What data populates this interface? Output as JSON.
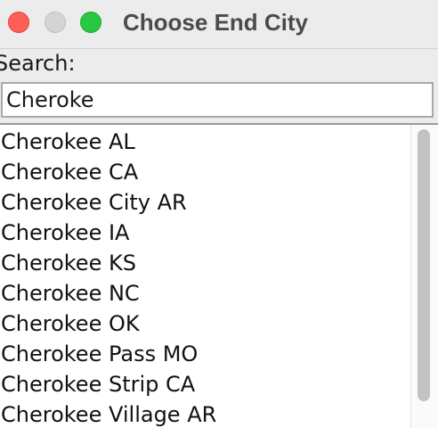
{
  "window": {
    "title": "Choose End City"
  },
  "search": {
    "label": "Search:",
    "value": "Cheroke"
  },
  "results": [
    "Cherokee AL",
    "Cherokee CA",
    "Cherokee City AR",
    "Cherokee IA",
    "Cherokee KS",
    "Cherokee NC",
    "Cherokee OK",
    "Cherokee Pass MO",
    "Cherokee Strip CA",
    "Cherokee Village AR"
  ],
  "colors": {
    "close": "#fe5f57",
    "minimize_disabled": "#d4d4d4",
    "maximize": "#2ac840"
  }
}
